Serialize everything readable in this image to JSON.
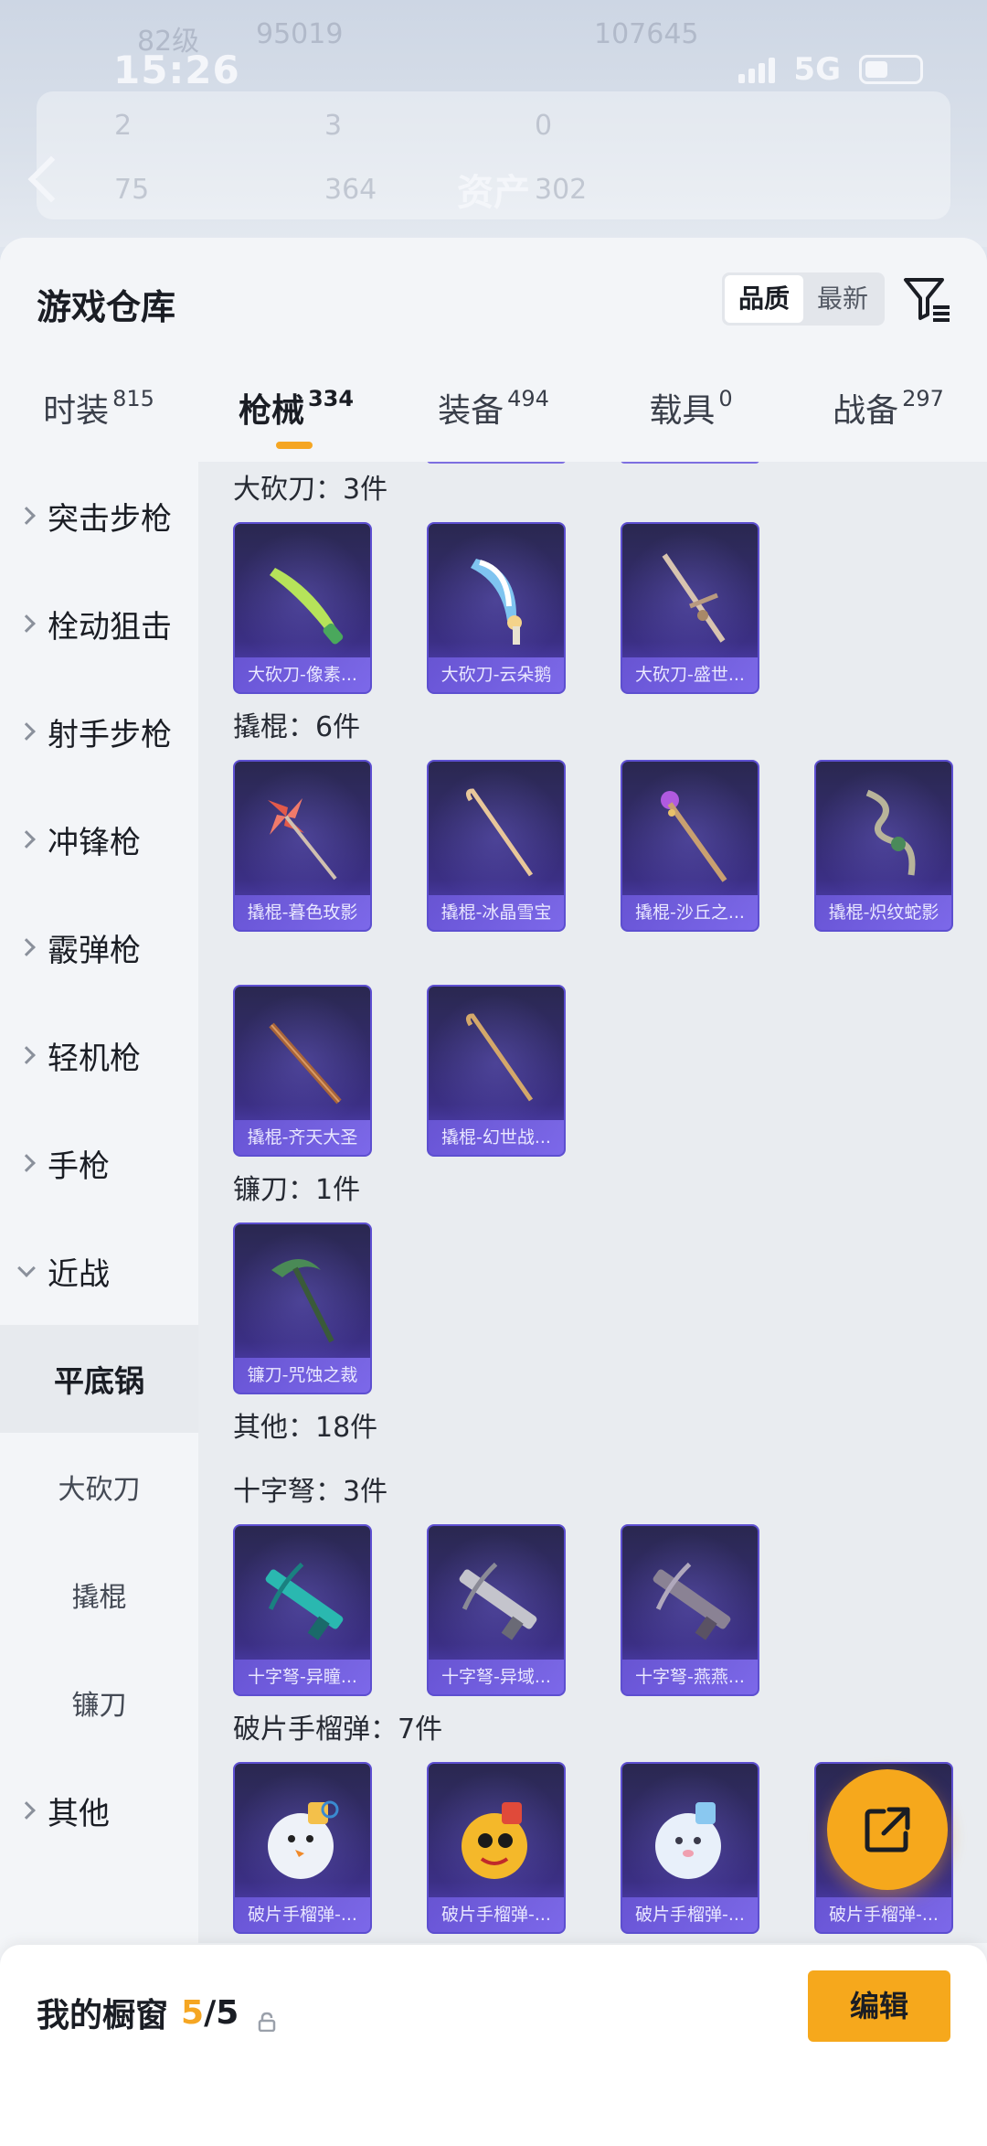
{
  "status_bar": {
    "time": "15:26",
    "network": "5G"
  },
  "header": {
    "title": "资产",
    "ghost_level": "82级",
    "ghost_coins": "95019",
    "ghost_points": "107645",
    "ghost_stats": [
      "2",
      "3",
      "0",
      "75",
      "364",
      "302"
    ]
  },
  "sheet": {
    "title": "游戏仓库",
    "sort": {
      "options": [
        "品质",
        "最新"
      ],
      "selected": "品质"
    },
    "tabs": [
      {
        "label": "时装",
        "count": "815"
      },
      {
        "label": "枪械",
        "count": "334",
        "active": true
      },
      {
        "label": "装备",
        "count": "494"
      },
      {
        "label": "载具",
        "count": "0"
      },
      {
        "label": "战备",
        "count": "297"
      }
    ]
  },
  "sidebar": {
    "categories": [
      "突击步枪",
      "栓动狙击",
      "射手步枪",
      "冲锋枪",
      "霰弹枪",
      "轻机枪",
      "手枪",
      "近战"
    ],
    "subcategories": [
      "平底锅",
      "大砍刀",
      "撬棍",
      "镰刀"
    ],
    "active_subcategory": "平底锅",
    "other": "其他"
  },
  "content": {
    "sections": [
      {
        "title": "大砍刀：3件",
        "items": [
          "大砍刀-像素...",
          "大砍刀-云朵鹅",
          "大砍刀-盛世..."
        ]
      },
      {
        "title": "撬棍：6件",
        "items": [
          "撬棍-暮色玫影",
          "撬棍-冰晶雪宝",
          "撬棍-沙丘之...",
          "撬棍-炽纹蛇影",
          "撬棍-齐天大圣",
          "撬棍-幻世战..."
        ]
      },
      {
        "title": "镰刀：1件",
        "items": [
          "镰刀-咒蚀之裁"
        ]
      },
      {
        "title": "其他：18件",
        "items": []
      },
      {
        "title": "十字弩：3件",
        "items": [
          "十字弩-异瞳...",
          "十字弩-异域...",
          "十字弩-燕燕..."
        ]
      },
      {
        "title": "破片手榴弹：7件",
        "items": [
          "破片手榴弹-...",
          "破片手榴弹-...",
          "破片手榴弹-...",
          "破片手榴弹-..."
        ]
      }
    ]
  },
  "bottom": {
    "showcase_label": "我的橱窗",
    "showcase_count": "5",
    "showcase_total": "/5",
    "edit_label": "编辑"
  },
  "colors": {
    "accent": "#f6a81c",
    "card_bg": "#3b2f84",
    "card_border": "#5d4fd0"
  }
}
